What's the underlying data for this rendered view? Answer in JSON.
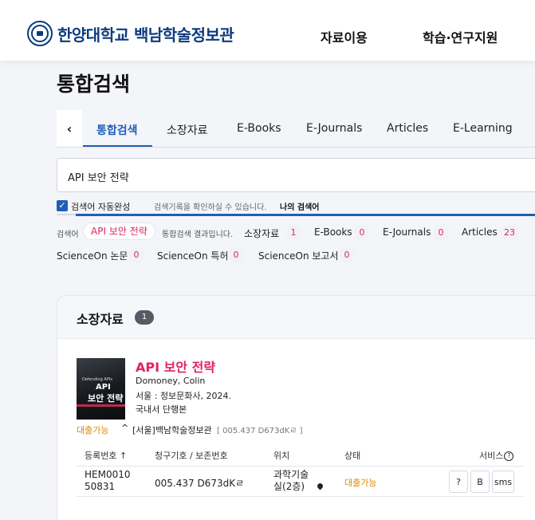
{
  "header": {
    "logo_text": "한양대학교 백남학술정보관",
    "nav": [
      "자료이용",
      "학습·연구지원"
    ]
  },
  "page_title": "통합검색",
  "tabs": [
    "통합검색",
    "소장자료",
    "E-Books",
    "E-Journals",
    "Articles",
    "E-Learning"
  ],
  "tab_prev": "‹",
  "search": {
    "value": "API 보안 전략"
  },
  "options": {
    "autocomplete_label": "검색어 자동완성",
    "history_text": "검색기록을 확인하실 수 있습니다.",
    "my_keywords": "나의 검색어"
  },
  "results_summary": {
    "prefix": "검색어",
    "keyword": "API 보안 전략",
    "suffix": "통합검색 결과입니다.",
    "counts": [
      {
        "label": "소장자료",
        "count": "1"
      },
      {
        "label": "E-Books",
        "count": "0"
      },
      {
        "label": "E-Journals",
        "count": "0"
      },
      {
        "label": "Articles",
        "count": "23"
      },
      {
        "label": "ScienceOn 논문",
        "count": "0"
      },
      {
        "label": "ScienceOn 특허",
        "count": "0"
      },
      {
        "label": "ScienceOn 보고서",
        "count": "0"
      }
    ]
  },
  "holdings": {
    "title": "소장자료",
    "count": "1",
    "book": {
      "cover_text": [
        "Defending APIs",
        "API",
        "보안 전략"
      ],
      "title": "API 보안 전략",
      "author": "Domoney, Colin",
      "publisher": "서울 : 정보문화사, 2024.",
      "type": "국내서 단행본"
    },
    "availability": {
      "status": "대출가능",
      "caret": "^",
      "location": "[서울]백남학술정보관",
      "call_number": "[ 005.437 D673dKㄹ ]"
    },
    "table": {
      "headers": [
        "등록번호 ↑",
        "청구기호 / 보존번호",
        "위치",
        "상태",
        "서비스"
      ],
      "help": "?",
      "rows": [
        {
          "reg_no": "HEM0010 50831",
          "call_no": "005.437 D673dKㄹ",
          "location": "과학기술 실(2층)",
          "status": "대출가능",
          "services": [
            "?",
            "B",
            "sms"
          ]
        }
      ]
    }
  }
}
